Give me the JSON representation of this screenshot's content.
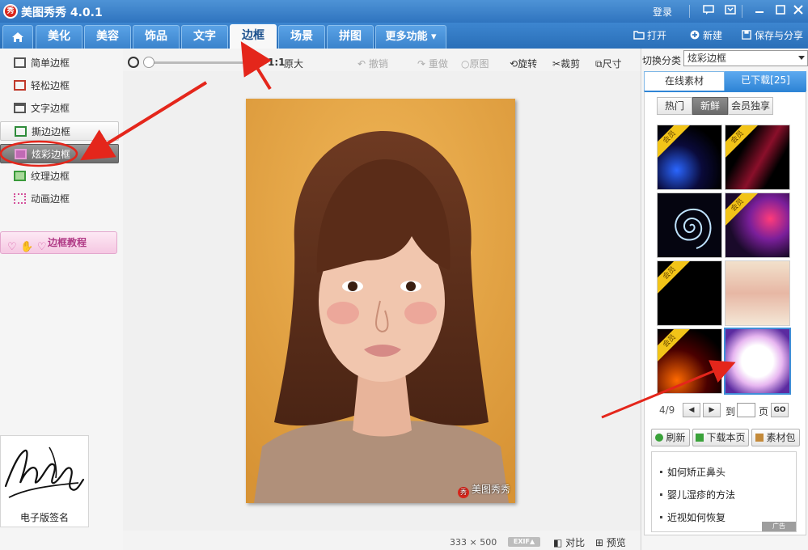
{
  "app": {
    "title": "美图秀秀 4.0.1",
    "logo_char": "秀",
    "login": "登录"
  },
  "tabs": [
    {
      "label": "美化"
    },
    {
      "label": "美容"
    },
    {
      "label": "饰品"
    },
    {
      "label": "文字"
    },
    {
      "label": "边框",
      "active": true
    },
    {
      "label": "场景"
    },
    {
      "label": "拼图"
    },
    {
      "label": "更多功能 ▾"
    }
  ],
  "toolbar_right": {
    "open": "打开",
    "new": "新建",
    "save": "保存与分享"
  },
  "sidebar": {
    "items": [
      {
        "label": "简单边框"
      },
      {
        "label": "轻松边框"
      },
      {
        "label": "文字边框"
      },
      {
        "label": "撕边边框"
      },
      {
        "label": "炫彩边框",
        "active": true
      },
      {
        "label": "纹理边框"
      },
      {
        "label": "动画边框"
      }
    ],
    "tutorial": "边框教程",
    "signature_label": "电子版签名"
  },
  "canvas_tools": {
    "ratio": "1:1",
    "original_size": "原大",
    "undo": "撤销",
    "redo": "重做",
    "original": "原图",
    "rotate": "旋转",
    "crop": "裁剪",
    "resize": "尺寸"
  },
  "photo": {
    "watermark": "美图秀秀"
  },
  "status": {
    "width": "333",
    "times": "×",
    "height": "500",
    "exif": "EXIF▲",
    "compare": "对比",
    "preview": "预览"
  },
  "right_panel": {
    "category_label": "切换分类",
    "category_value": "炫彩边框",
    "tab_online": "在线素材",
    "tab_downloaded": "已下载[25]",
    "filters": [
      "热门",
      "新鲜",
      "会员独享"
    ],
    "member_badge": "会员",
    "pager": {
      "current": "4/9",
      "prev": "◀",
      "next": "▶",
      "to": "到",
      "page": "页",
      "go": "GO"
    },
    "actions": {
      "refresh": "刷新",
      "download_page": "下载本页",
      "pack": "素材包"
    },
    "ads": [
      "如何矫正鼻头",
      "婴儿湿疹的方法",
      "近视如何恢复"
    ],
    "ad_tag": "广告"
  },
  "colors": {
    "title_bar": "#3a80c8",
    "accent": "#2f85d6",
    "annotation_red": "#e4261b",
    "member_ribbon": "#f2c418"
  }
}
